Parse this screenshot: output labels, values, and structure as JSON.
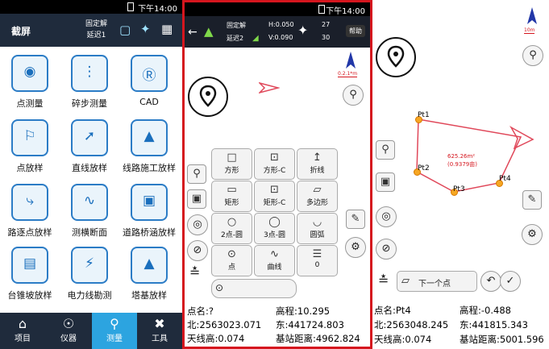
{
  "panel1": {
    "status_time": "下午14:00",
    "header": {
      "title": "截屏",
      "fix_status": "固定解",
      "delay": "延迟1"
    },
    "tiles": [
      {
        "label": "点测量"
      },
      {
        "label": "碎步测量"
      },
      {
        "label": "CAD"
      },
      {
        "label": "点放样"
      },
      {
        "label": "直线放样"
      },
      {
        "label": "线路施工放样"
      },
      {
        "label": "路逐点放样"
      },
      {
        "label": "测横断面"
      },
      {
        "label": "道路桥涵放样"
      },
      {
        "label": "台锥坡放样"
      },
      {
        "label": "电力线勘测"
      },
      {
        "label": "塔基放样"
      }
    ],
    "tabs": [
      {
        "label": "项目"
      },
      {
        "label": "仪器"
      },
      {
        "label": "测量"
      },
      {
        "label": "工具"
      }
    ]
  },
  "panel2": {
    "status_time": "下午14:00",
    "header": {
      "fix_status": "固定解",
      "delay": "延迟2",
      "h_precision": "H:0.050",
      "v_precision": "V:0.090",
      "sat_top": "27",
      "sat_bottom": "30",
      "help_label": "帮助"
    },
    "scale_text": "0.2.1*m",
    "shapes": [
      {
        "label": "方形",
        "icon": "square-icon"
      },
      {
        "label": "方形-C",
        "icon": "square-center-icon"
      },
      {
        "label": "折线",
        "icon": "polyline-icon"
      },
      {
        "label": "矩形",
        "icon": "rect-icon"
      },
      {
        "label": "矩形-C",
        "icon": "rect-center-icon"
      },
      {
        "label": "多边形",
        "icon": "polygon-icon"
      },
      {
        "label": "2点-圆",
        "icon": "circle-2pt-icon"
      },
      {
        "label": "3点-圆",
        "icon": "circle-3pt-icon"
      },
      {
        "label": "圆弧",
        "icon": "arc-icon"
      },
      {
        "label": "点",
        "icon": "point-icon"
      },
      {
        "label": "曲线",
        "icon": "curve-icon"
      },
      {
        "label": "0",
        "icon": "layers-icon"
      }
    ],
    "info": {
      "name": "点名:?",
      "elevation": "高程:10.295",
      "north": "北:2563023.071",
      "east": "东:441724.803",
      "antenna": "天线高:0.074",
      "base_distance": "基站距离:4962.824"
    }
  },
  "panel3": {
    "scale_text": "10m",
    "points": [
      {
        "label": "Pt1"
      },
      {
        "label": "Pt2"
      },
      {
        "label": "Pt3"
      },
      {
        "label": "Pt4"
      }
    ],
    "area_text": "625.26m²",
    "area_sub": "(0.9379亩)",
    "next_point_label": "下一个点",
    "info": {
      "name": "点名:Pt4",
      "elevation": "高程:-0.488",
      "north": "北:2563048.245",
      "east": "东:441815.343",
      "antenna": "天线高:0.074",
      "base_distance": "基站距离:5001.596"
    }
  },
  "colors": {
    "highlight_frame": "#d5161e",
    "header_dark": "#1f2b3c",
    "tab_active": "#2ca4e0",
    "polygon": "#e0485a",
    "point": "#f6a723"
  }
}
